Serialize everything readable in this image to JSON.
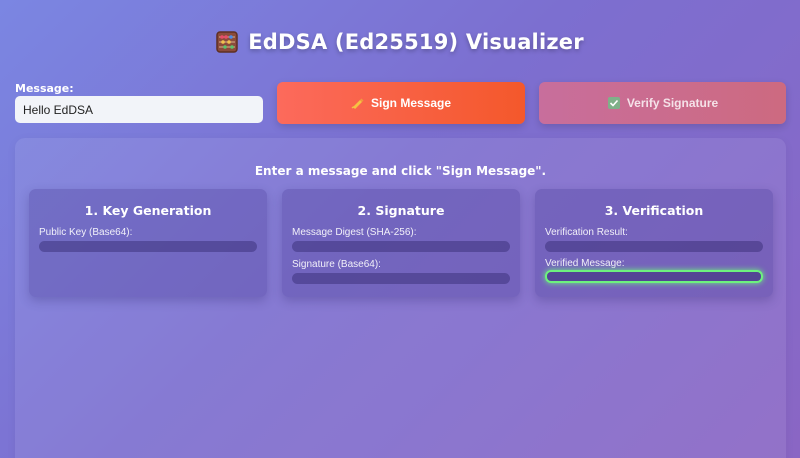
{
  "header": {
    "title": "EdDSA (Ed25519) Visualizer",
    "icon": "abacus-icon"
  },
  "controls": {
    "message_label": "Message:",
    "message_value": "Hello EdDSA",
    "sign_label": "Sign Message",
    "sign_icon": "writing-hand-icon",
    "verify_label": "Verify Signature",
    "verify_icon": "check-box-icon"
  },
  "status": "Enter a message and click \"Sign Message\".",
  "cards": [
    {
      "title": "1. Key Generation",
      "fields": [
        {
          "label": "Public Key (Base64):",
          "value": ""
        }
      ]
    },
    {
      "title": "2. Signature",
      "fields": [
        {
          "label": "Message Digest (SHA-256):",
          "value": ""
        },
        {
          "label": "Signature (Base64):",
          "value": ""
        }
      ]
    },
    {
      "title": "3. Verification",
      "fields": [
        {
          "label": "Verification Result:",
          "value": ""
        },
        {
          "label": "Verified Message:",
          "value": ""
        }
      ]
    }
  ],
  "colors": {
    "sign_button": "#f4582b",
    "verify_button": "#cd6a80",
    "success_glow": "#6df27e"
  }
}
